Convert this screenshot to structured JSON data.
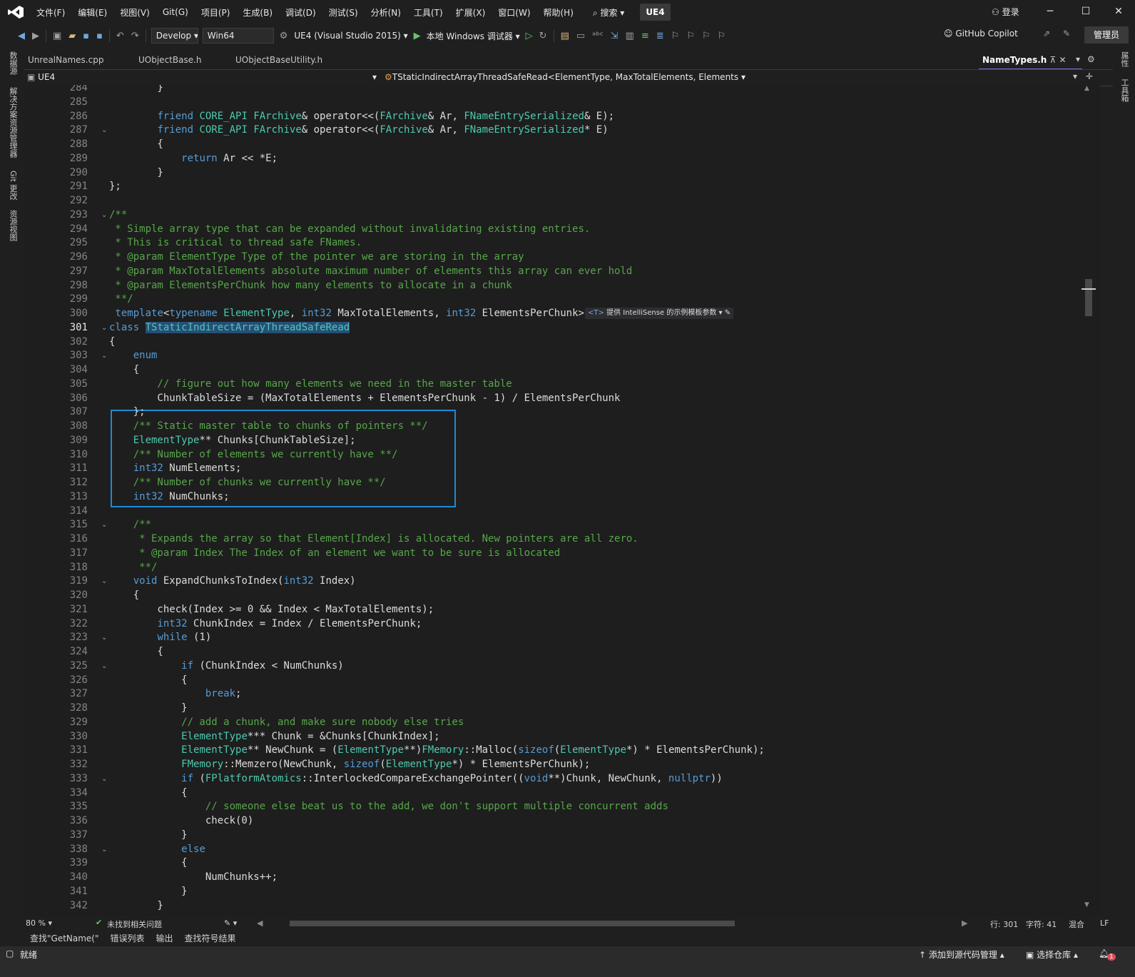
{
  "menubar": {
    "items": [
      "文件(F)",
      "编辑(E)",
      "视图(V)",
      "Git(G)",
      "项目(P)",
      "生成(B)",
      "调试(D)",
      "测试(S)",
      "分析(N)",
      "工具(T)",
      "扩展(X)",
      "窗口(W)",
      "帮助(H)"
    ],
    "search": "搜索",
    "solution": "UE4",
    "login": "登录"
  },
  "toolbar": {
    "config": "Develop",
    "platform": "Win64",
    "project": "UE4 (Visual Studio 2015)",
    "debugger": "本地 Windows 调试器",
    "copilot": "GitHub Copilot",
    "admin": "管理员"
  },
  "left_rail": [
    "数据源",
    "解决方案资源管理器",
    "Git 更改",
    "资源视图"
  ],
  "right_rail": [
    "属性",
    "工具箱"
  ],
  "tabs": [
    "UnrealNames.cpp",
    "UObjectBase.h",
    "UObjectBaseUtility.h",
    "NameTypes.h"
  ],
  "navbar": {
    "scope": "UE4",
    "member": "TStaticIndirectArrayThreadSafeRead<ElementType, MaxTotalElements, Elements"
  },
  "code": {
    "lines": [
      {
        "n": "284",
        "t": "        }"
      },
      {
        "n": "285",
        "t": ""
      },
      {
        "n": "286",
        "t": "        friend CORE_API FArchive& operator<<(FArchive& Ar, FNameEntrySerialized& E);"
      },
      {
        "n": "287",
        "t": "        friend CORE_API FArchive& operator<<(FArchive& Ar, FNameEntrySerialized* E)"
      },
      {
        "n": "288",
        "t": "        {"
      },
      {
        "n": "289",
        "t": "            return Ar << *E;"
      },
      {
        "n": "290",
        "t": "        }"
      },
      {
        "n": "291",
        "t": "};"
      },
      {
        "n": "292",
        "t": ""
      },
      {
        "n": "293",
        "t": "/**"
      },
      {
        "n": "294",
        "t": " * Simple array type that can be expanded without invalidating existing entries."
      },
      {
        "n": "295",
        "t": " * This is critical to thread safe FNames."
      },
      {
        "n": "296",
        "t": " * @param ElementType Type of the pointer we are storing in the array"
      },
      {
        "n": "297",
        "t": " * @param MaxTotalElements absolute maximum number of elements this array can ever hold"
      },
      {
        "n": "298",
        "t": " * @param ElementsPerChunk how many elements to allocate in a chunk"
      },
      {
        "n": "299",
        "t": " **/"
      },
      {
        "n": "300",
        "t": " template<typename ElementType, int32 MaxTotalElements, int32 ElementsPerChunk>"
      },
      {
        "n": "301",
        "t": "class TStaticIndirectArrayThreadSafeRead"
      },
      {
        "n": "302",
        "t": "{"
      },
      {
        "n": "303",
        "t": "    enum"
      },
      {
        "n": "304",
        "t": "    {"
      },
      {
        "n": "305",
        "t": "        // figure out how many elements we need in the master table"
      },
      {
        "n": "306",
        "t": "        ChunkTableSize = (MaxTotalElements + ElementsPerChunk - 1) / ElementsPerChunk"
      },
      {
        "n": "307",
        "t": "    };"
      },
      {
        "n": "308",
        "t": "    /** Static master table to chunks of pointers **/"
      },
      {
        "n": "309",
        "t": "    ElementType** Chunks[ChunkTableSize];"
      },
      {
        "n": "310",
        "t": "    /** Number of elements we currently have **/"
      },
      {
        "n": "311",
        "t": "    int32 NumElements;"
      },
      {
        "n": "312",
        "t": "    /** Number of chunks we currently have **/"
      },
      {
        "n": "313",
        "t": "    int32 NumChunks;"
      },
      {
        "n": "314",
        "t": ""
      },
      {
        "n": "315",
        "t": "    /**"
      },
      {
        "n": "316",
        "t": "     * Expands the array so that Element[Index] is allocated. New pointers are all zero."
      },
      {
        "n": "317",
        "t": "     * @param Index The Index of an element we want to be sure is allocated"
      },
      {
        "n": "318",
        "t": "     **/"
      },
      {
        "n": "319",
        "t": "    void ExpandChunksToIndex(int32 Index)"
      },
      {
        "n": "320",
        "t": "    {"
      },
      {
        "n": "321",
        "t": "        check(Index >= 0 && Index < MaxTotalElements);"
      },
      {
        "n": "322",
        "t": "        int32 ChunkIndex = Index / ElementsPerChunk;"
      },
      {
        "n": "323",
        "t": "        while (1)"
      },
      {
        "n": "324",
        "t": "        {"
      },
      {
        "n": "325",
        "t": "            if (ChunkIndex < NumChunks)"
      },
      {
        "n": "326",
        "t": "            {"
      },
      {
        "n": "327",
        "t": "                break;"
      },
      {
        "n": "328",
        "t": "            }"
      },
      {
        "n": "329",
        "t": "            // add a chunk, and make sure nobody else tries"
      },
      {
        "n": "330",
        "t": "            ElementType*** Chunk = &Chunks[ChunkIndex];"
      },
      {
        "n": "331",
        "t": "            ElementType** NewChunk = (ElementType**)FMemory::Malloc(sizeof(ElementType*) * ElementsPerChunk);"
      },
      {
        "n": "332",
        "t": "            FMemory::Memzero(NewChunk, sizeof(ElementType*) * ElementsPerChunk);"
      },
      {
        "n": "333",
        "t": "            if (FPlatformAtomics::InterlockedCompareExchangePointer((void**)Chunk, NewChunk, nullptr))"
      },
      {
        "n": "334",
        "t": "            {"
      },
      {
        "n": "335",
        "t": "                // someone else beat us to the add, we don't support multiple concurrent adds"
      },
      {
        "n": "336",
        "t": "                check(0)"
      },
      {
        "n": "337",
        "t": "            }"
      },
      {
        "n": "338",
        "t": "            else"
      },
      {
        "n": "339",
        "t": "            {"
      },
      {
        "n": "340",
        "t": "                NumChunks++;"
      },
      {
        "n": "341",
        "t": "            }"
      },
      {
        "n": "342",
        "t": "        }"
      }
    ],
    "current_line": "301",
    "selected_text": "TStaticIndirectArrayThreadSafeRead",
    "intellisense_hint": "提供 IntelliSense 的示例模板参数"
  },
  "editor_status": {
    "zoom": "80 %",
    "issues": "未找到相关问题",
    "line": "行: 301",
    "col": "字符: 41",
    "indent": "混合",
    "eol": "LF"
  },
  "bottom_tabs": [
    "查找\"GetName(\"",
    "错误列表",
    "输出",
    "查找符号结果"
  ],
  "statusbar": {
    "ready": "就绪",
    "source_control": "添加到源代码管理",
    "repo": "选择仓库",
    "notifications": "1"
  },
  "colors": {
    "keyword": "#569cd6",
    "type": "#4ec9b0",
    "comment": "#57a64a",
    "highlight_box": "#1e8ad6",
    "accent": "#8a6bd6"
  }
}
